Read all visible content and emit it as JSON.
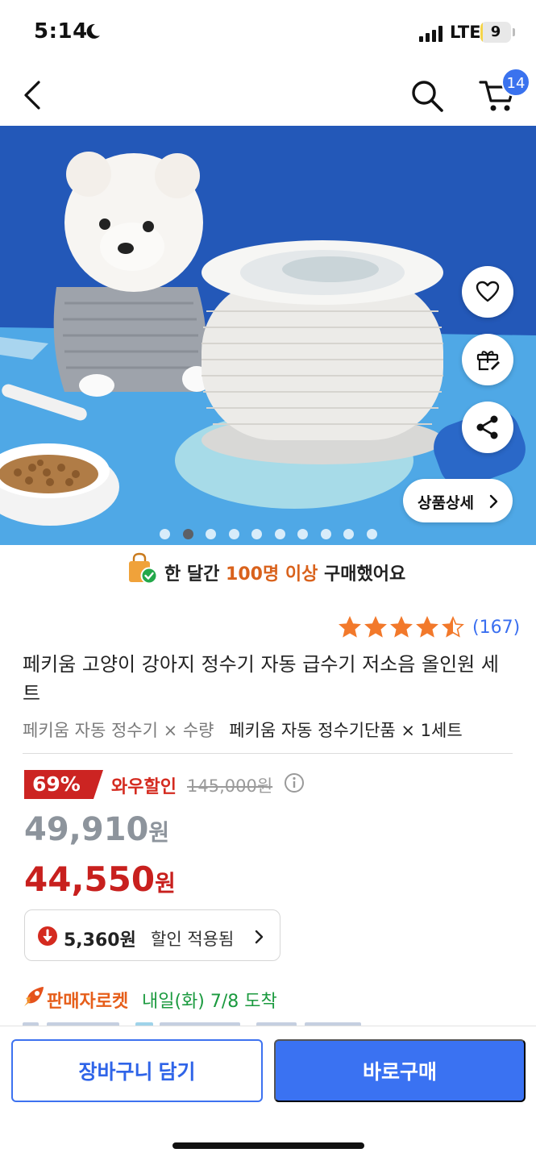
{
  "status_bar": {
    "time": "5:14",
    "network": "LTE",
    "battery": "9",
    "battery_level": 0.09
  },
  "nav": {
    "icons": [
      "chevron-left-icon",
      "search-icon",
      "cart-icon"
    ],
    "cart_badge": "14"
  },
  "hero": {
    "slide_count": 10,
    "active_slide_index": 1,
    "float_buttons": [
      "heart-icon",
      "gift-icon",
      "share-icon"
    ],
    "detail_button": "상품상세",
    "colors": {
      "background": "#1f4fa8",
      "table": "#4fa8e6"
    }
  },
  "purchase_banner": {
    "prefix": "한 달간 ",
    "highlight": "100명 이상",
    "suffix": " 구매했어요",
    "highlight_color": "#d9621c"
  },
  "rating": {
    "stars": 4.5,
    "max": 5,
    "count": "(167)",
    "star_color": "#f2792b"
  },
  "product": {
    "title": "페키움 고양이 강아지 정수기 자동 급수기 저소음 올인원 세트",
    "option_label": "페키움 자동 정수기 × 수량",
    "option_value": "페키움 자동 정수기단품 × 1세트"
  },
  "price": {
    "discount_rate": "69%",
    "wow_label": "와우할인",
    "original": "145,000원",
    "sale_amount": "49,910",
    "final_amount": "44,550",
    "unit": "원",
    "coupon_amount": "5,360원",
    "coupon_label": "할인 적용됨",
    "accent_color": "#c8201e"
  },
  "delivery": {
    "badge": "판매자로켓",
    "arrival": "내일(화) 7/8 도착"
  },
  "bottom_bar": {
    "add_to_cart": "장바구니 담기",
    "buy_now": "바로구매",
    "primary_color": "#3a72f2"
  }
}
